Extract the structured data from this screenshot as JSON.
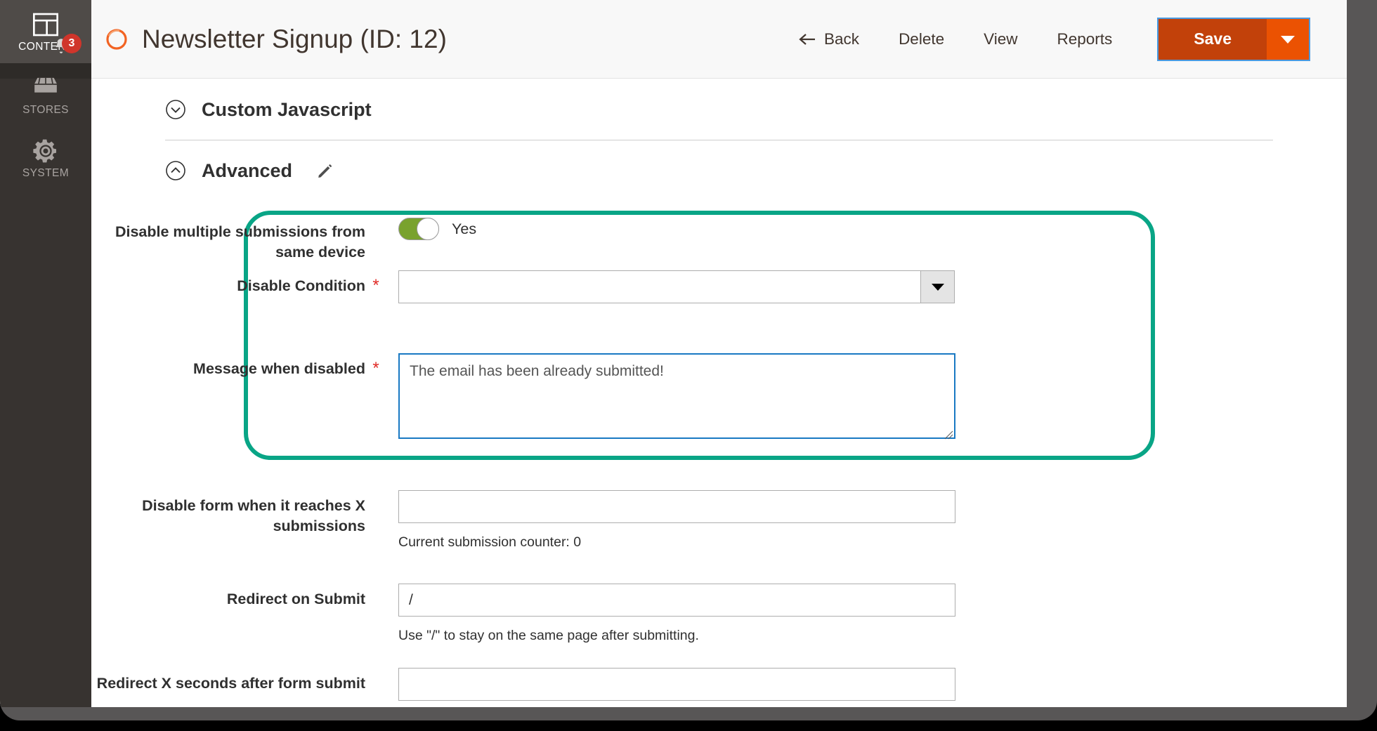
{
  "window": {
    "frame_color": "#585656"
  },
  "sidebar": {
    "logo_icon": "magento-logo-icon",
    "items": [
      {
        "label": "CONTENT",
        "icon": "content-layout-icon",
        "active": true,
        "badge": "3"
      },
      {
        "label": "STORES",
        "icon": "store-icon",
        "active": false
      },
      {
        "label": "SYSTEM",
        "icon": "gear-icon",
        "active": false
      }
    ]
  },
  "header": {
    "status_icon": "orange-ring-icon",
    "title": "Newsletter Signup (ID: 12)",
    "actions": {
      "back": "Back",
      "back_icon": "arrow-left-icon",
      "delete": "Delete",
      "view": "View",
      "reports": "Reports",
      "save": "Save",
      "save_arrow_icon": "caret-down-icon"
    },
    "colors": {
      "save_bg": "#c2410a",
      "save_arrow_bg": "#eb5202",
      "focus_outline": "#4a9ae0"
    }
  },
  "sections": [
    {
      "title": "Custom Javascript",
      "collapse_icon": "chevron-down-circle-icon",
      "expanded": false
    },
    {
      "title": "Advanced",
      "collapse_icon": "chevron-up-circle-icon",
      "expanded": true,
      "edit_icon": "pencil-icon"
    }
  ],
  "highlight": {
    "color": "#09a586",
    "note": "teal rounded highlight around first three advanced fields"
  },
  "form": {
    "fields": [
      {
        "label": "Disable multiple submissions from same device",
        "required": false,
        "control": "toggle",
        "toggle_on": true,
        "toggle_value_text": "Yes",
        "toggle_color": "#79a22e"
      },
      {
        "label": "Disable Condition",
        "required": true,
        "required_mark": "*",
        "control": "select",
        "value": "",
        "arrow_icon": "caret-down-icon"
      },
      {
        "label": "Message when disabled",
        "required": true,
        "required_mark": "*",
        "control": "textarea",
        "value": "The email has been already submitted!",
        "focused": true,
        "focus_color": "#1979c3"
      },
      {
        "label": "Disable form when it reaches X submissions",
        "required": false,
        "control": "text",
        "value": "",
        "hint": "Current submission counter: 0"
      },
      {
        "label": "Redirect on Submit",
        "required": false,
        "control": "text",
        "value": "/",
        "hint": "Use \"/\" to stay on the same page after submitting."
      },
      {
        "label": "Redirect X seconds after form submit",
        "required": false,
        "control": "text",
        "value": ""
      }
    ]
  }
}
